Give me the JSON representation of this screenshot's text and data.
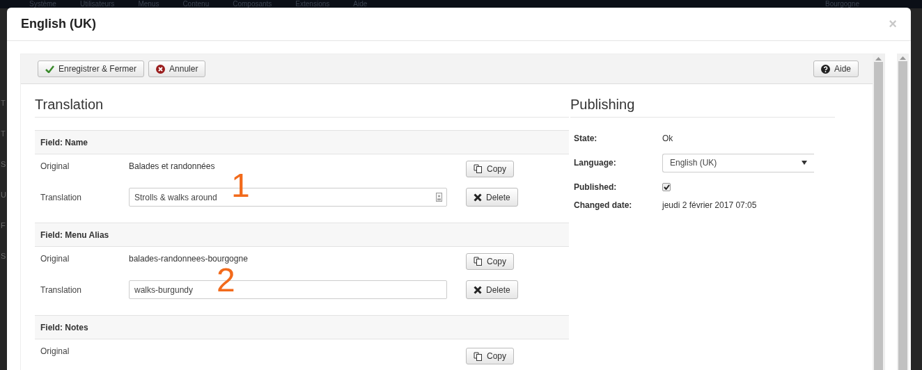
{
  "backdrop": {
    "menu": [
      "Système",
      "Utilisateurs",
      "Menus",
      "Contenu",
      "Composants",
      "Extensions",
      "Aide"
    ],
    "site": "Bourgogne",
    "side_labels": [
      "T",
      "T",
      "S",
      "U",
      "F",
      "S"
    ]
  },
  "modal": {
    "title": "English (UK)",
    "close": "×"
  },
  "toolbar": {
    "buttons": [
      {
        "kind": "save",
        "label": "Enregistrer & Fermer"
      },
      {
        "kind": "cancel",
        "label": "Annuler"
      }
    ],
    "help": {
      "kind": "help",
      "label": "Aide"
    }
  },
  "translation": {
    "heading": "Translation",
    "fields": [
      {
        "title": "Field: Name",
        "original_label": "Original",
        "original": "Balades et randonnées",
        "copy": "Copy",
        "translation_label": "Translation",
        "value": "Strolls & walks around",
        "has_counter": true,
        "delete": "Delete",
        "annotation": "1"
      },
      {
        "title": "Field: Menu Alias",
        "original_label": "Original",
        "original": "balades-randonnees-bourgogne",
        "copy": "Copy",
        "translation_label": "Translation",
        "value": "walks-burgundy",
        "has_counter": false,
        "delete": "Delete",
        "annotation": "2"
      },
      {
        "title": "Field: Notes",
        "original_label": "Original",
        "copy": "Copy"
      }
    ]
  },
  "publishing": {
    "heading": "Publishing",
    "state_label": "State:",
    "state": "Ok",
    "language_label": "Language:",
    "language": "English (UK)",
    "published_label": "Published:",
    "published": true,
    "changed_label": "Changed date:",
    "changed": "jeudi 2 février 2017 07:05"
  }
}
